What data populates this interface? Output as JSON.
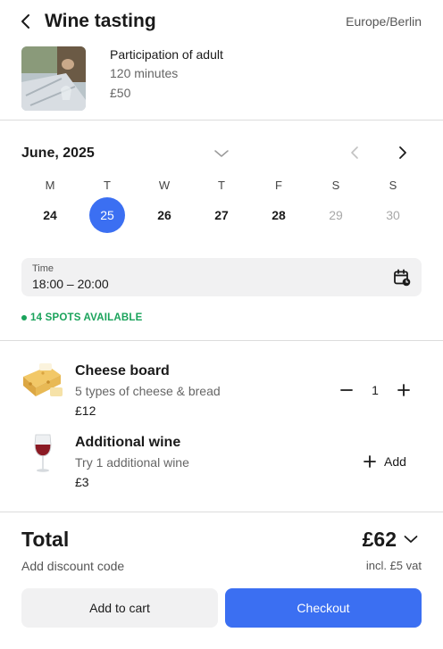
{
  "header": {
    "title": "Wine tasting",
    "timezone": "Europe/Berlin",
    "back_icon": "chevron-left-icon"
  },
  "product": {
    "name": "Participation of adult",
    "duration": "120 minutes",
    "price": "£50"
  },
  "calendar": {
    "month": "June, 2025",
    "weekdays": [
      "M",
      "T",
      "W",
      "T",
      "F",
      "S",
      "S"
    ],
    "days": [
      {
        "label": "24",
        "state": "available"
      },
      {
        "label": "25",
        "state": "selected"
      },
      {
        "label": "26",
        "state": "available"
      },
      {
        "label": "27",
        "state": "available"
      },
      {
        "label": "28",
        "state": "available"
      },
      {
        "label": "29",
        "state": "unavailable"
      },
      {
        "label": "30",
        "state": "unavailable"
      }
    ],
    "accent_color": "#3b6ff2"
  },
  "time": {
    "label": "Time",
    "value": "18:00 – 20:00"
  },
  "availability": {
    "text": "14 SPOTS AVAILABLE",
    "color": "#1aa35b"
  },
  "addons": [
    {
      "name": "Cheese board",
      "description": "5 types of cheese & bread",
      "price": "£12",
      "quantity": "1"
    },
    {
      "name": "Additional wine",
      "description": "Try 1 additional wine",
      "price": "£3",
      "add_label": "Add"
    }
  ],
  "footer": {
    "total_label": "Total",
    "total_amount": "£62",
    "discount_label": "Add discount code",
    "vat_label": "incl. £5 vat",
    "add_to_cart_label": "Add to cart",
    "checkout_label": "Checkout"
  }
}
